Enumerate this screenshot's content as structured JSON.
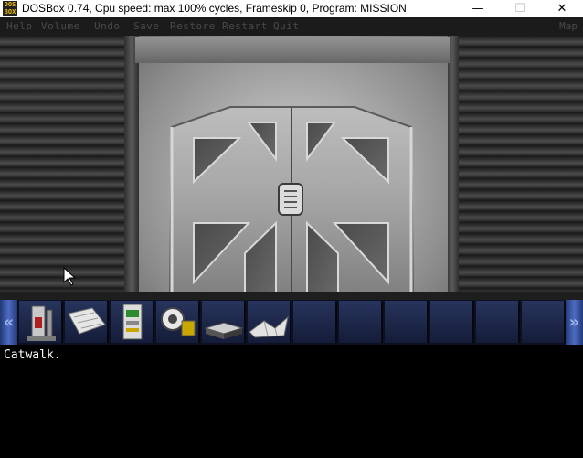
{
  "window": {
    "icon_text": "DOS BOX",
    "title": "DOSBox 0.74, Cpu speed: max 100% cycles, Frameskip  0, Program:  MISSION",
    "controls": {
      "minimize": "—",
      "maximize": "☐",
      "close": "✕"
    }
  },
  "menu": {
    "items": [
      "Help",
      "Volume",
      "Undo",
      "Save",
      "Restore",
      "Restart",
      "Quit"
    ],
    "map": "Map"
  },
  "inventory": {
    "left_arrow": "«",
    "right_arrow": "»",
    "items": [
      {
        "icon": "spray-can-icon"
      },
      {
        "icon": "paper-sheet-icon"
      },
      {
        "icon": "device-card-icon"
      },
      {
        "icon": "tape-reel-icon"
      },
      {
        "icon": "box-icon"
      },
      {
        "icon": "folded-cloth-icon"
      },
      {
        "icon": ""
      },
      {
        "icon": ""
      },
      {
        "icon": ""
      },
      {
        "icon": ""
      },
      {
        "icon": ""
      },
      {
        "icon": ""
      }
    ]
  },
  "text_output": "Catwalk."
}
